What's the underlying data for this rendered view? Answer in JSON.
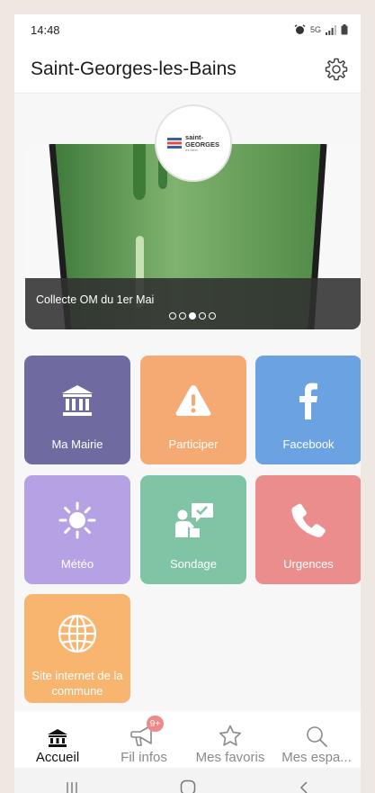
{
  "status_bar": {
    "time": "14:48",
    "network": "5G"
  },
  "header": {
    "title": "Saint-Georges-les-Bains"
  },
  "banner": {
    "caption": "Collecte OM du 1er Mai",
    "active_slide": 3,
    "slide_count": 5,
    "logo": {
      "name": "saint-",
      "name2": "GEORGES",
      "sub": "les bains"
    }
  },
  "tiles": [
    {
      "label": "Ma Mairie",
      "color": "#6f6aa0",
      "icon": "town-hall-icon"
    },
    {
      "label": "Participer",
      "color": "#f5aa73",
      "icon": "warning-icon"
    },
    {
      "label": "Facebook",
      "color": "#6aa2e2",
      "icon": "facebook-icon"
    },
    {
      "label": "Météo",
      "color": "#b5a2e4",
      "icon": "sun-icon"
    },
    {
      "label": "Sondage",
      "color": "#7ec4a5",
      "icon": "survey-icon"
    },
    {
      "label": "Urgences",
      "color": "#ec8d8d",
      "icon": "phone-icon"
    },
    {
      "label": "Site internet de la commune",
      "color": "#f7b570",
      "icon": "globe-icon"
    }
  ],
  "bottom_nav": [
    {
      "label": "Accueil",
      "icon": "home-icon",
      "active": true
    },
    {
      "label": "Fil infos",
      "icon": "megaphone-icon",
      "badge": "9+"
    },
    {
      "label": "Mes favoris",
      "icon": "star-icon"
    },
    {
      "label": "Mes espa...",
      "icon": "search-icon"
    }
  ]
}
